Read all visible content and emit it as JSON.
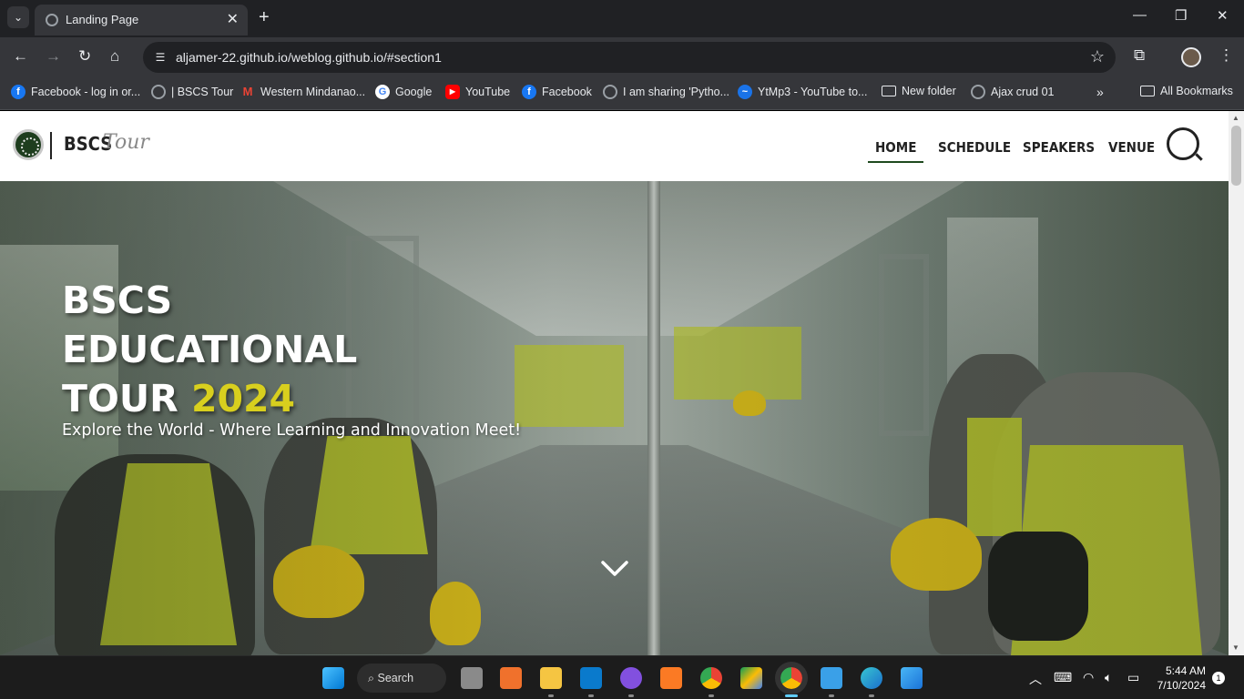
{
  "browser": {
    "tab_title": "Landing Page",
    "url": "aljamer-22.github.io/weblog.github.io/#section1",
    "bookmarks": [
      {
        "label": "Facebook - log in or...",
        "icon": "facebook-icon",
        "color": "#1877f2"
      },
      {
        "label": "| BSCS Tour",
        "icon": "globe-icon",
        "color": "#9aa0a6"
      },
      {
        "label": "Western Mindanao...",
        "icon": "gmail-icon",
        "color": "#ea4335"
      },
      {
        "label": "Google",
        "icon": "google-icon",
        "color": "#4285f4"
      },
      {
        "label": "YouTube",
        "icon": "youtube-icon",
        "color": "#ff0000"
      },
      {
        "label": "Facebook",
        "icon": "facebook-icon",
        "color": "#1877f2"
      },
      {
        "label": "I am sharing 'Pytho...",
        "icon": "globe-icon",
        "color": "#9aa0a6"
      },
      {
        "label": "YtMp3 - YouTube to...",
        "icon": "ytmp3-icon",
        "color": "#1a73e8"
      },
      {
        "label": "New folder",
        "icon": "folder-icon",
        "color": "#e8eaed"
      },
      {
        "label": "Ajax crud 01",
        "icon": "globe-icon",
        "color": "#9aa0a6"
      }
    ],
    "all_bookmarks_label": "All Bookmarks"
  },
  "site": {
    "brand": "BSCS",
    "brand_script": "Tour",
    "nav": [
      "HOME",
      "SCHEDULE",
      "SPEAKERS",
      "VENUE"
    ],
    "active_nav": "HOME",
    "accent_color": "#d8cf1e",
    "nav_underline_color": "#1f4a1f"
  },
  "hero": {
    "title_line1": "BSCS",
    "title_line2": "EDUCATIONAL",
    "title_line3_prefix": "TOUR",
    "title_year": "2024",
    "subtitle": "Explore the World - Where Learning and Innovation Meet!"
  },
  "taskbar": {
    "search_label": "Search",
    "time": "5:44 AM",
    "date": "7/10/2024",
    "notification_count": "1"
  }
}
